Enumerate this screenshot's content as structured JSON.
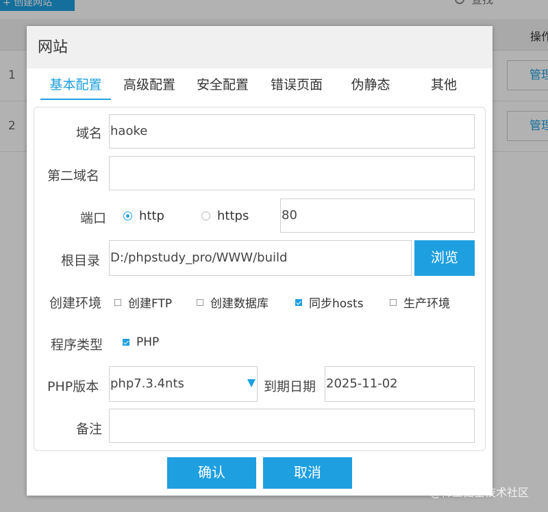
{
  "background": {
    "create_site_label": "创建网站",
    "search_label": "查找",
    "header_operation": "操作",
    "rows": [
      {
        "num": "1",
        "manage": "管理"
      },
      {
        "num": "2",
        "manage": "管理"
      }
    ]
  },
  "dialog": {
    "title": "网站",
    "tabs": [
      "基本配置",
      "高级配置",
      "安全配置",
      "错误页面",
      "伪静态",
      "其他"
    ],
    "form": {
      "domain_label": "域名",
      "domain_value": "haoke",
      "second_domain_label": "第二域名",
      "second_domain_value": "",
      "port_label": "端口",
      "protocol_http": "http",
      "protocol_https": "https",
      "port_value": "80",
      "root_label": "根目录",
      "root_value": "D:/phpstudy_pro/WWW/build",
      "browse_label": "浏览",
      "env_label": "创建环境",
      "env_ftp": "创建FTP",
      "env_db": "创建数据库",
      "env_hosts": "同步hosts",
      "env_prod": "生产环境",
      "program_label": "程序类型",
      "program_php": "PHP",
      "php_version_label": "PHP版本",
      "php_version_value": "php7.3.4nts",
      "expire_label": "到期日期",
      "expire_value": "2025-11-02",
      "note_label": "备注",
      "note_value": ""
    },
    "confirm_label": "确认",
    "cancel_label": "取消"
  },
  "watermark": "@稀土掘金技术社区",
  "colors": {
    "accent": "#1e9fe0",
    "header_bg": "#f0f0f0"
  }
}
